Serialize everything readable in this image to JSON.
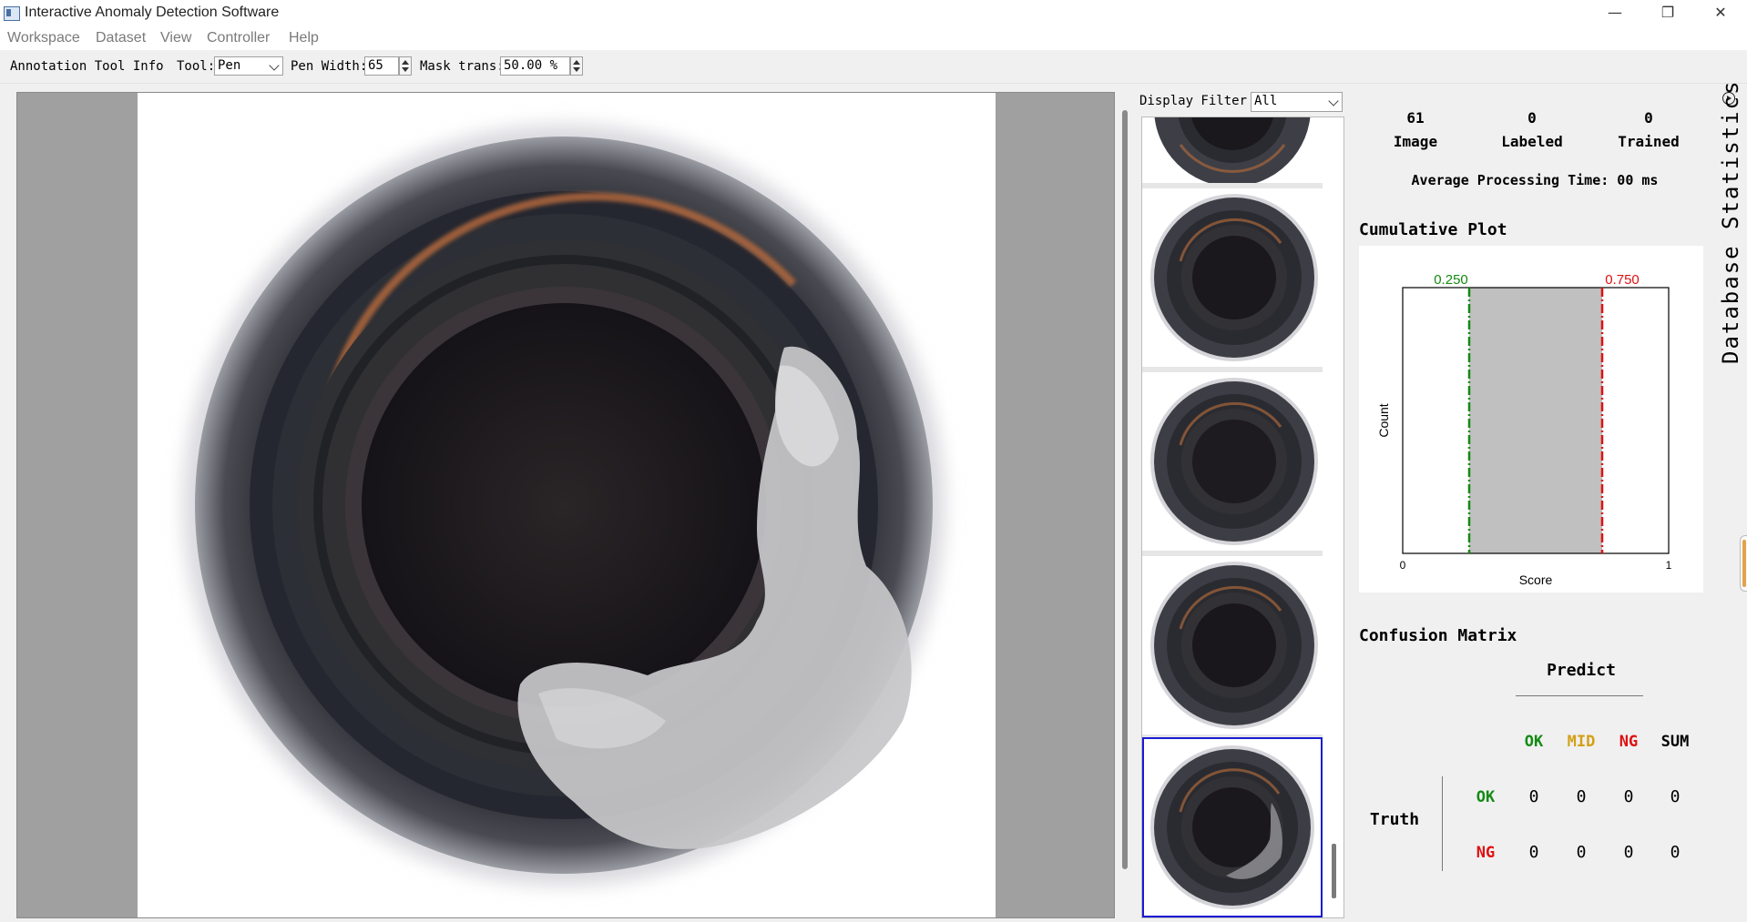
{
  "window": {
    "title": "Interactive Anomaly Detection Software",
    "controls": {
      "minimize": "—",
      "restore": "❐",
      "close": "✕"
    }
  },
  "menu": [
    "Workspace",
    "Dataset",
    "View",
    "Controller",
    "Help"
  ],
  "toolbar": {
    "info_label": "Annotation Tool Info",
    "tool_label": "Tool:",
    "tool_value": "Pen",
    "pen_width_label": "Pen Width:",
    "pen_width_value": "65",
    "mask_trans_label": "Mask trans:",
    "mask_trans_value": "50.00 %"
  },
  "thumbnails": {
    "filter_label": "Display Filter",
    "filter_value": "All",
    "selected_index": 4,
    "items": [
      {
        "name": "bottle-thumb-1",
        "defect": false
      },
      {
        "name": "bottle-thumb-2",
        "defect": false
      },
      {
        "name": "bottle-thumb-3",
        "defect": false
      },
      {
        "name": "bottle-thumb-4",
        "defect": false
      },
      {
        "name": "bottle-thumb-5",
        "defect": true
      }
    ]
  },
  "stats": {
    "image_count": "61",
    "image_label": "Image",
    "labeled_count": "0",
    "labeled_label": "Labeled",
    "trained_count": "0",
    "trained_label": "Trained",
    "avg_time": "Average Processing Time: 00 ms"
  },
  "cumulative_plot": {
    "title": "Cumulative Plot",
    "ok_threshold": "0.250",
    "ng_threshold": "0.750",
    "xlabel": "Score",
    "ylabel": "Count",
    "x_min": "0",
    "x_max": "1",
    "colors": {
      "ok": "#138a13",
      "ng": "#e01010",
      "band": "#c0c0c0"
    }
  },
  "chart_data": {
    "type": "area",
    "title": "",
    "xlabel": "Score",
    "ylabel": "Count",
    "xlim": [
      0,
      1
    ],
    "shaded_band": [
      0.25,
      0.75
    ],
    "thresholds": [
      0.25,
      0.75
    ],
    "series": []
  },
  "confusion_matrix": {
    "title": "Confusion Matrix",
    "predict_label": "Predict",
    "truth_label": "Truth",
    "columns": [
      "OK",
      "MID",
      "NG",
      "SUM"
    ],
    "column_colors": [
      "#138a13",
      "#d4a017",
      "#e01010",
      "#000000"
    ],
    "rows": [
      {
        "label": "OK",
        "color": "#138a13",
        "values": [
          "0",
          "0",
          "0",
          "0"
        ]
      },
      {
        "label": "NG",
        "color": "#e01010",
        "values": [
          "0",
          "0",
          "0",
          "0"
        ]
      }
    ]
  },
  "side_tab": {
    "label": "Database Statistics"
  }
}
